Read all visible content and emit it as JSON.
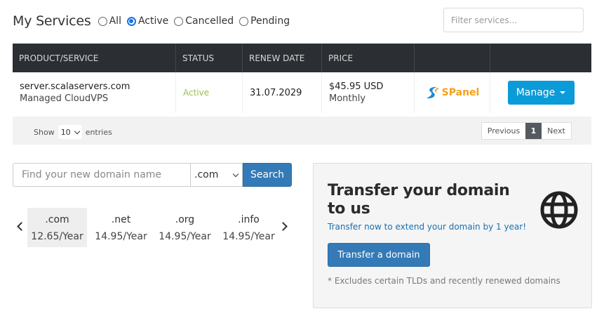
{
  "header": {
    "title": "My Services",
    "filters": [
      {
        "label": "All",
        "checked": false
      },
      {
        "label": "Active",
        "checked": true
      },
      {
        "label": "Cancelled",
        "checked": false
      },
      {
        "label": "Pending",
        "checked": false
      }
    ],
    "search_placeholder": "Filter services..."
  },
  "table": {
    "columns": [
      "PRODUCT/SERVICE",
      "STATUS",
      "RENEW DATE",
      "PRICE",
      "",
      ""
    ],
    "rows": [
      {
        "product": "server.scalaservers.com",
        "plan": "Managed CloudVPS",
        "status": "Active",
        "renew_date": "31.07.2029",
        "price": "$45.95 USD",
        "cycle": "Monthly",
        "panel_logo": "SPanel",
        "action": "Manage"
      }
    ],
    "footer": {
      "show_label": "Show",
      "entries_value": "10",
      "entries_label": "entries",
      "prev": "Previous",
      "page": "1",
      "next": "Next"
    }
  },
  "domain_search": {
    "placeholder": "Find your new domain name",
    "tld_selected": ".com",
    "button": "Search",
    "tlds": [
      {
        "ext": ".com",
        "price": "12.65/Year"
      },
      {
        "ext": ".net",
        "price": "14.95/Year"
      },
      {
        "ext": ".org",
        "price": "14.95/Year"
      },
      {
        "ext": ".info",
        "price": "14.95/Year"
      }
    ]
  },
  "transfer": {
    "title": "Transfer your domain to us",
    "subtitle": "Transfer now to extend your domain by 1 year!",
    "button": "Transfer a domain",
    "note": "* Excludes certain TLDs and recently renewed domains",
    "icon": "globe-icon"
  },
  "colors": {
    "table_header_bg": "#2b2f33",
    "status_active": "#9bbf4c",
    "manage_button": "#0b9bd8",
    "primary_button": "#337ab7",
    "link": "#1a6fb0",
    "spanel_orange": "#f4a11b"
  }
}
